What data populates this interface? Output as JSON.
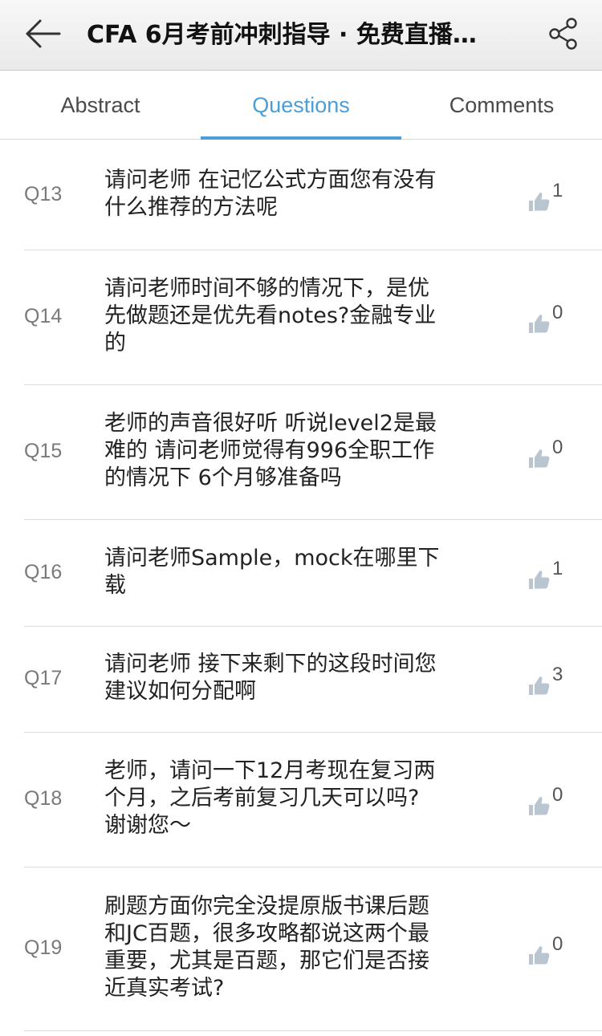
{
  "header": {
    "title": "CFA 6月考前冲刺指导 · 免费直播…",
    "back_icon": "back-arrow-icon",
    "share_icon": "share-icon"
  },
  "tabs": [
    {
      "label": "Abstract",
      "active": false
    },
    {
      "label": "Questions",
      "active": true
    },
    {
      "label": "Comments",
      "active": false
    }
  ],
  "colors": {
    "accent": "#4a9fd8",
    "icon_gray": "#b9c6d2"
  },
  "questions": [
    {
      "id": "Q13",
      "lines": [
        "请问老师 在记忆公式方面您有没有",
        "什么推荐的方法呢"
      ],
      "likes": "1"
    },
    {
      "id": "Q14",
      "lines": [
        "请问老师时间不够的情况下，是优",
        "先做题还是优先看notes?金融专业",
        "的"
      ],
      "likes": "0"
    },
    {
      "id": "Q15",
      "lines": [
        "老师的声音很好听 听说level2是最",
        "难的 请问老师觉得有996全职工作",
        "的情况下 6个月够准备吗"
      ],
      "likes": "0"
    },
    {
      "id": "Q16",
      "lines": [
        "请问老师Sample，mock在哪里下",
        "载"
      ],
      "likes": "1"
    },
    {
      "id": "Q17",
      "lines": [
        "请问老师 接下来剩下的这段时间您",
        "建议如何分配啊"
      ],
      "likes": "3"
    },
    {
      "id": "Q18",
      "lines": [
        "老师，请问一下12月考现在复习两",
        "个月，之后考前复习几天可以吗?",
        "谢谢您～"
      ],
      "likes": "0"
    },
    {
      "id": "Q19",
      "lines": [
        "刷题方面你完全没提原版书课后题",
        "和JC百题，很多攻略都说这两个最",
        "重要，尤其是百题，那它们是否接",
        "近真实考试?"
      ],
      "likes": "0"
    }
  ]
}
